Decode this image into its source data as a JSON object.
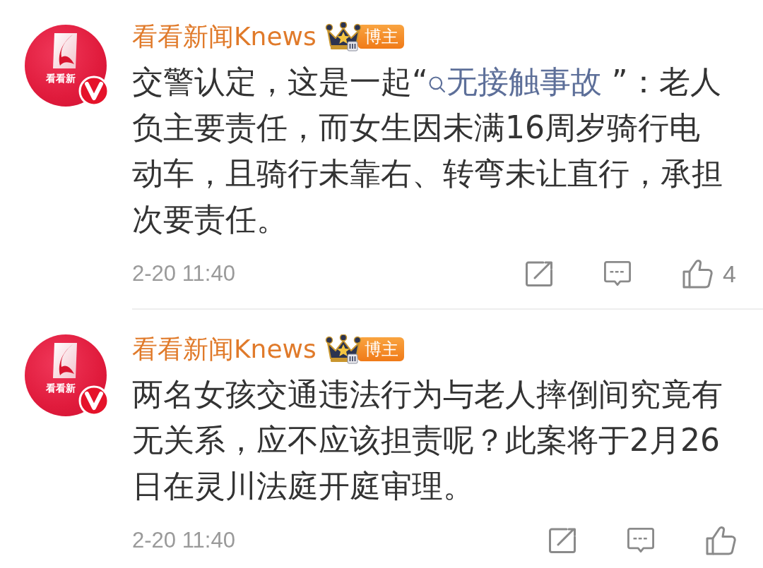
{
  "posts": [
    {
      "avatar_caption": "看看新",
      "verified": true,
      "name": "看看新闻Knews",
      "badge": "博主",
      "body": [
        {
          "kind": "text",
          "text": "交警认定，这是一起“"
        },
        {
          "kind": "topic",
          "text": "无接触事故"
        },
        {
          "kind": "text",
          "text": " ”：老人负主要责任，而女生因未满16周岁骑行电动车，且骑行未靠右、转弯未让直行，承担次要责任。"
        }
      ],
      "time": "2-20 11:40",
      "likes": "4"
    },
    {
      "avatar_caption": "看看新",
      "verified": true,
      "name": "看看新闻Knews",
      "badge": "博主",
      "body": [
        {
          "kind": "text",
          "text": "两名女孩交通违法行为与老人摔倒间究竟有无关系，应不应该担责呢？此案将于2月26日在灵川法庭开庭审理。"
        }
      ],
      "time": "2-20 11:40"
    }
  ]
}
